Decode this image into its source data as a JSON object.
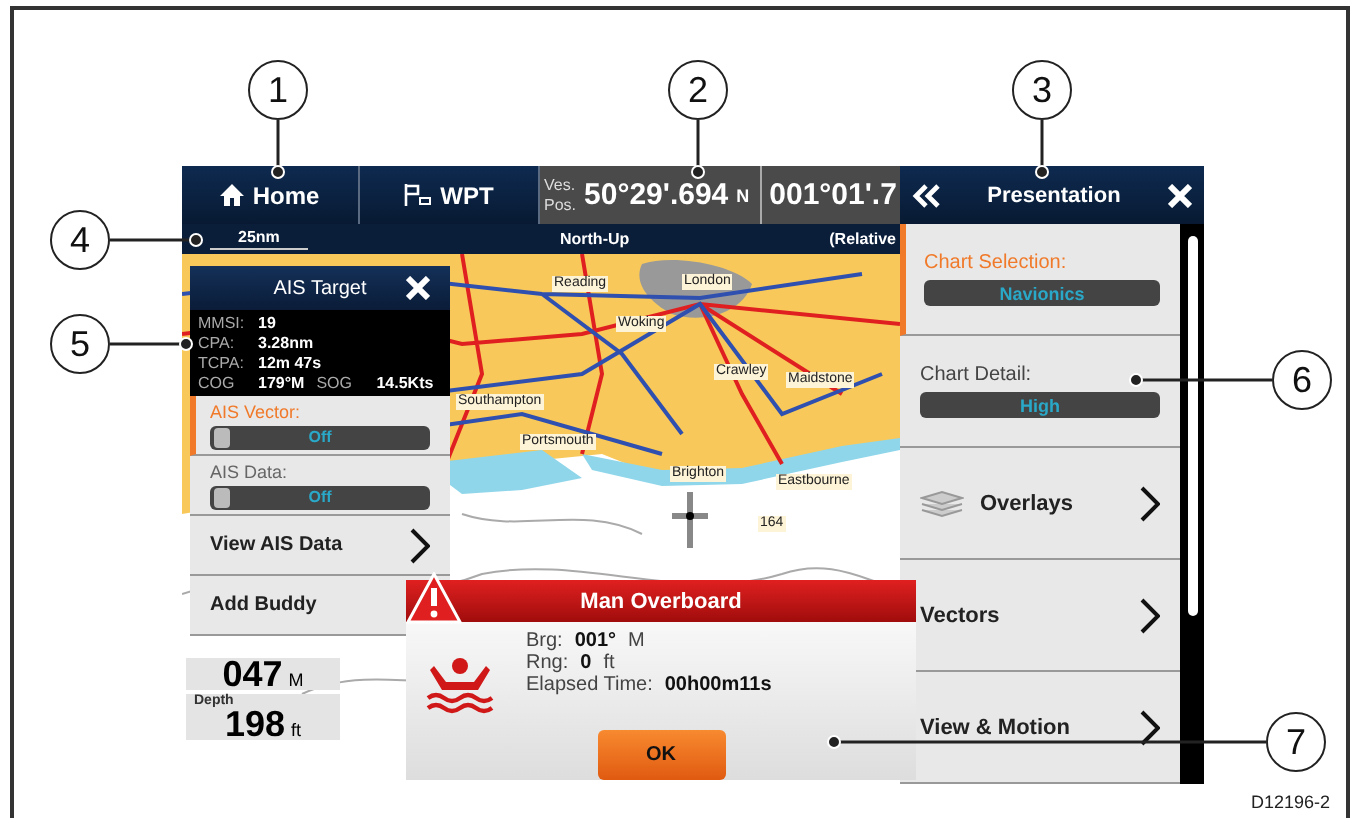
{
  "callouts": [
    "1",
    "2",
    "3",
    "4",
    "5",
    "6",
    "7"
  ],
  "top_bar": {
    "home": "Home",
    "wpt": "WPT",
    "position": {
      "label_1": "Ves.",
      "label_2": "Pos.",
      "latitude": "50°29'.694",
      "lat_hemisphere": "N",
      "longitude": "001°01'.7"
    }
  },
  "chart_bar": {
    "scale": "25nm",
    "orientation": "North-Up",
    "motion": "(Relative"
  },
  "map_labels": [
    "London",
    "Reading",
    "Woking",
    "Crawley",
    "Maidstone",
    "Southampton",
    "Portsmouth",
    "Brighton",
    "Eastbourne",
    "164"
  ],
  "data_boxes": [
    {
      "value": "047",
      "unit": "M"
    },
    {
      "label": "Depth",
      "value": "198",
      "unit": "ft"
    }
  ],
  "ais_target": {
    "title": "AIS Target",
    "details": [
      {
        "label": "MMSI:",
        "value": "19"
      },
      {
        "label": "CPA:",
        "value": "3.28nm"
      },
      {
        "label": "TCPA:",
        "value": "12m 47s"
      }
    ],
    "course": {
      "cog_label": "COG",
      "cog": "179°M",
      "sog_label": "SOG",
      "sog": "14.5Kts"
    },
    "items": [
      {
        "kind": "toggle",
        "label": "AIS Vector:",
        "value": "Off",
        "on": false,
        "selected": true
      },
      {
        "kind": "toggle",
        "label": "AIS Data:",
        "value": "Off",
        "on": false,
        "selected": false
      },
      {
        "kind": "submenu",
        "label": "View AIS Data",
        "selected": false
      },
      {
        "kind": "action",
        "label": "Add Buddy",
        "selected": false
      }
    ]
  },
  "mob_dialog": {
    "title": "Man Overboard",
    "rows": [
      {
        "label": "Brg:",
        "value": "001°",
        "unit": "M"
      },
      {
        "label": "Rng:",
        "value": "0",
        "unit": "ft"
      },
      {
        "label": "Elapsed Time:",
        "value": "00h00m11s"
      }
    ],
    "button": "OK"
  },
  "presentation": {
    "title": "Presentation",
    "items": [
      {
        "kind": "selector",
        "label": "Chart Selection:",
        "value": "Navionics",
        "selected": true
      },
      {
        "kind": "selector",
        "label": "Chart Detail:",
        "value": "High",
        "selected": false
      },
      {
        "kind": "layers",
        "label": "Overlays",
        "selected": false
      },
      {
        "kind": "submenu",
        "label": "Vectors",
        "selected": false
      },
      {
        "kind": "submenu",
        "label": "View & Motion",
        "selected": false
      }
    ]
  },
  "figure_id": "D12196-2"
}
